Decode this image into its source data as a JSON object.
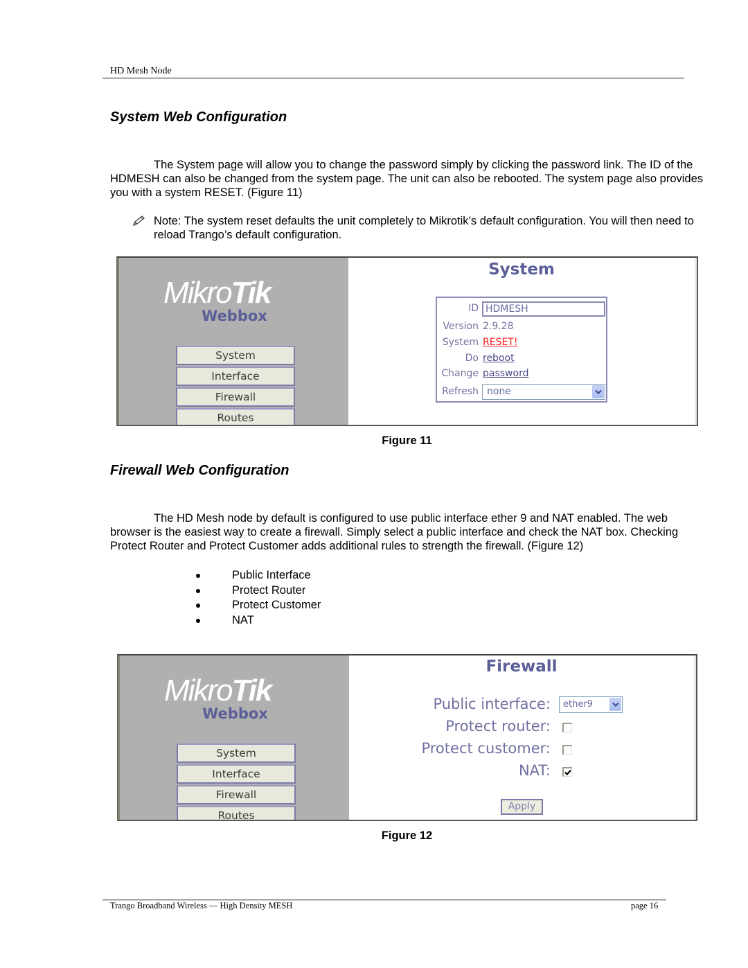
{
  "header": {
    "running_title": "HD Mesh Node"
  },
  "section1": {
    "title": "System Web Configuration",
    "paragraph": "The System page will allow you to change the password simply by clicking the password link. The ID of the HDMESH can also be changed from the system page. The unit can also be rebooted. The system page also provides you with a system RESET. (Figure 11)",
    "note_icon": "pencil-icon",
    "note": "Note: The system reset defaults the unit completely to Mikrotik’s default configuration. You will then need to reload Trango’s default configuration."
  },
  "figure11": {
    "caption": "Figure 11",
    "logo": {
      "mikro": "Mikro",
      "tik": "Tik",
      "subtitle": "Webbox"
    },
    "nav": [
      "System",
      "Interface",
      "Firewall",
      "Routes"
    ],
    "page_title": "System",
    "rows": {
      "id_label": "ID",
      "id_value": "HDMESH",
      "version_label": "Version",
      "version_value": "2.9.28",
      "system_label": "System",
      "system_link": "RESET!",
      "do_label": "Do",
      "do_link": "reboot",
      "change_label": "Change",
      "change_link": "password",
      "refresh_label": "Refresh",
      "refresh_value": "none"
    },
    "colors": {
      "accent": "#5b5f98",
      "reset_link": "#ff1a1a",
      "sidebar": "#b0b0b0",
      "nav_button": "#e8e8dc"
    }
  },
  "section2": {
    "title": "Firewall Web Configuration",
    "paragraph": "The HD Mesh node by default is configured to use public interface ether 9 and NAT enabled. The web browser is the easiest way to create a firewall. Simply select a public interface and check the NAT box. Checking Protect Router and Protect Customer adds additional rules to strength the firewall. (Figure 12)",
    "bullets": [
      "Public Interface",
      "Protect Router",
      "Protect Customer",
      "NAT"
    ]
  },
  "figure12": {
    "caption": "Figure 12",
    "logo": {
      "mikro": "Mikro",
      "tik": "Tik",
      "subtitle": "Webbox"
    },
    "nav": [
      "System",
      "Interface",
      "Firewall",
      "Routes"
    ],
    "page_title": "Firewall",
    "public_interface_label": "Public interface:",
    "public_interface_value": "ether9",
    "protect_router_label": "Protect router:",
    "protect_router_checked": false,
    "protect_customer_label": "Protect customer:",
    "protect_customer_checked": false,
    "nat_label": "NAT:",
    "nat_checked": true,
    "apply_label": "Apply"
  },
  "footer": {
    "left": "Trango Broadband Wireless — High Density MESH",
    "right": "page 16"
  }
}
